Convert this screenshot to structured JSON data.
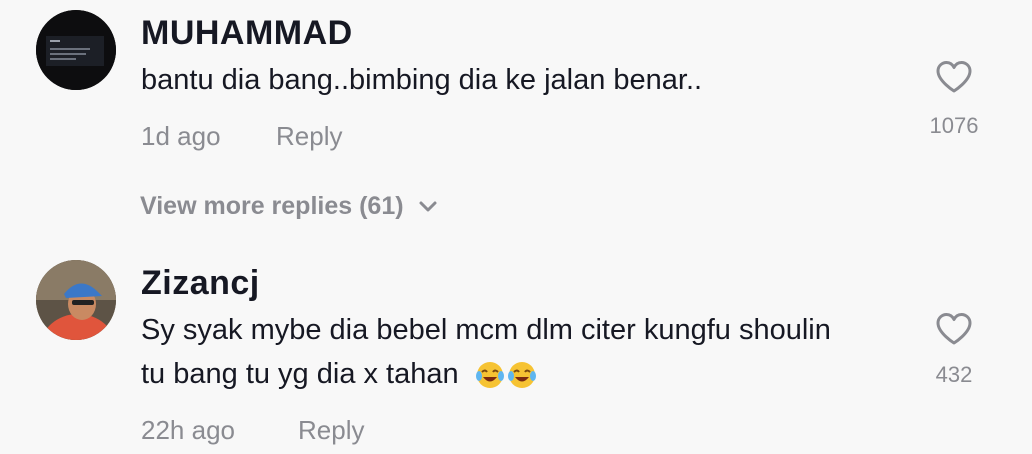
{
  "comments": [
    {
      "username": "MUHAMMAD",
      "text_lines": [
        "bantu dia bang..bimbing dia ke jalan benar.."
      ],
      "time": "1d ago",
      "reply_label": "Reply",
      "like_count": "1076",
      "avatar_icon": "dark-screenshot-avatar"
    },
    {
      "username": "Zizancj",
      "text_lines": [
        "Sy syak mybe dia bebel mcm dlm citer kungfu shoulin",
        "tu bang tu yg dia x tahan"
      ],
      "emoji": "😂😂",
      "time": "22h ago",
      "reply_label": "Reply",
      "like_count": "432",
      "avatar_icon": "person-photo-avatar"
    }
  ],
  "view_more_replies": {
    "label": "View more replies (61)",
    "icon": "chevron-down-icon"
  },
  "colors": {
    "background": "#f8f8f8",
    "primary_text": "#161823",
    "secondary_text": "#8a8b91"
  }
}
